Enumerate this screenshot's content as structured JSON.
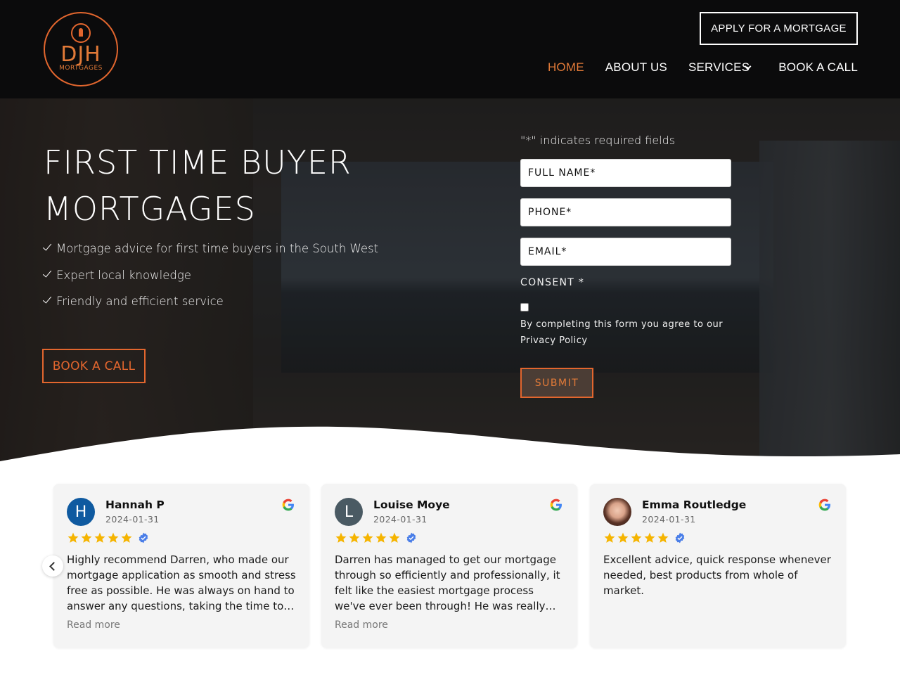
{
  "header": {
    "logo": {
      "word": "DJH",
      "sub": "MORTGAGES"
    },
    "apply_label": "APPLY FOR A MORTGAGE",
    "nav": [
      {
        "label": "HOME",
        "active": true
      },
      {
        "label": "ABOUT US",
        "active": false
      },
      {
        "label": "SERVICES",
        "active": false,
        "has_dropdown": true
      },
      {
        "label": "BOOK A CALL",
        "active": false
      }
    ]
  },
  "hero": {
    "title_line1": "FIRST TIME BUYER",
    "title_line2": "MORTGAGES",
    "bullets": [
      "Mortgage advice for first time buyers in the South West",
      "Expert local knowledge",
      "Friendly and efficient service"
    ],
    "cta_label": "BOOK A CALL"
  },
  "form": {
    "required_note": "\"*\" indicates required fields",
    "full_name_placeholder": "FULL NAME*",
    "phone_placeholder": "PHONE*",
    "email_placeholder": "EMAIL*",
    "consent_label": "CONSENT *",
    "consent_text": "By completing this form you agree to our Privacy Policy",
    "submit_label": "SUBMIT"
  },
  "reviews": [
    {
      "initial": "H",
      "avatar_color": "#0f5aa0",
      "name": "Hannah P",
      "date": "2024-01-31",
      "rating": 5,
      "text": "Highly recommend Darren, who made our mortgage application as smooth and stress free as possible. He was always on hand to answer any questions, taking the time to explain everything clearly.",
      "more_label": "Read more"
    },
    {
      "initial": "L",
      "avatar_color": "#4a5a63",
      "name": "Louise Moye",
      "date": "2024-01-31",
      "rating": 5,
      "text": "Darren has managed to get our mortgage through so efficiently and professionally, it felt like the easiest mortgage process we've ever been through! He was really helpful throughout.",
      "more_label": "Read more"
    },
    {
      "initial": "",
      "avatar_color": "photo",
      "name": "Emma Routledge",
      "date": "2024-01-31",
      "rating": 5,
      "text": "Excellent advice, quick response whenever needed, best products from whole of market.",
      "more_label": ""
    }
  ],
  "colors": {
    "accent": "#e2662e",
    "header_bg": "#0b0b0c",
    "star": "#f5b400",
    "verified": "#4a7ee8"
  }
}
